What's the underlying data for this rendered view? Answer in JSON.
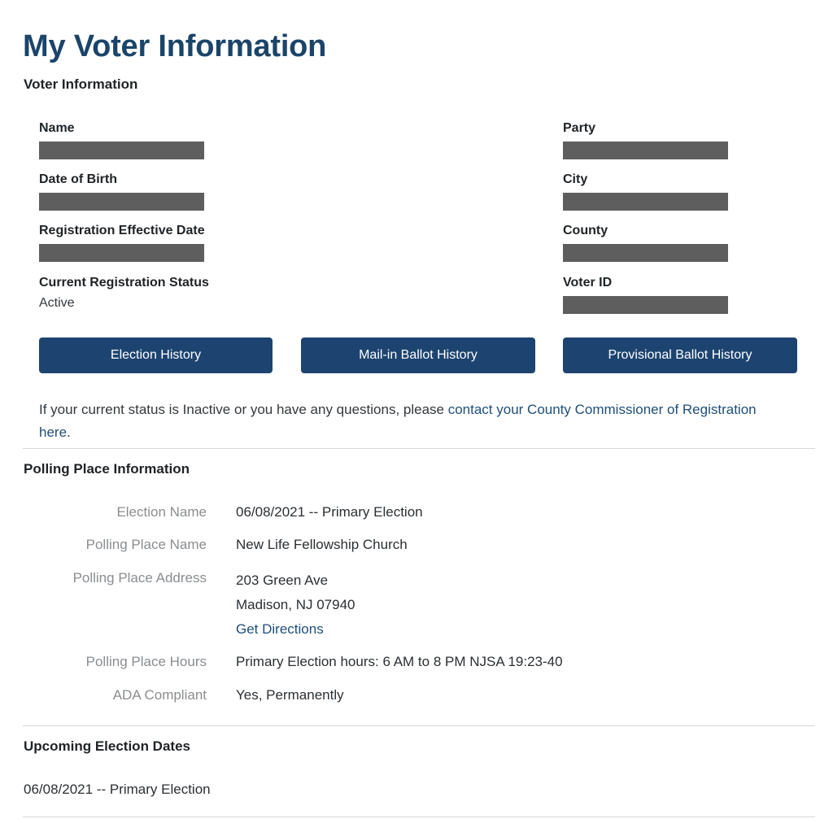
{
  "page": {
    "title": "My Voter Information"
  },
  "voter_information": {
    "heading": "Voter Information",
    "left_fields": [
      {
        "label": "Name",
        "value": "",
        "redacted": true
      },
      {
        "label": "Date of Birth",
        "value": "",
        "redacted": true
      },
      {
        "label": "Registration Effective Date",
        "value": "",
        "redacted": true
      },
      {
        "label": "Current Registration Status",
        "value": "Active",
        "redacted": false
      }
    ],
    "right_fields": [
      {
        "label": "Party",
        "value": "",
        "redacted": true
      },
      {
        "label": "City",
        "value": "",
        "redacted": true
      },
      {
        "label": "County",
        "value": "",
        "redacted": true
      },
      {
        "label": "Voter ID",
        "value": "",
        "redacted": true
      }
    ],
    "buttons": [
      {
        "label": "Election History"
      },
      {
        "label": "Mail-in Ballot History"
      },
      {
        "label": "Provisional Ballot History"
      }
    ],
    "status_note": {
      "text_before": "If your current status is Inactive or you have any questions, please ",
      "link_text": "contact your County Commissioner of Registration here",
      "text_after": "."
    }
  },
  "polling_place_information": {
    "heading": "Polling Place Information",
    "rows": [
      {
        "label": "Election Name",
        "value": "06/08/2021 -- Primary Election"
      },
      {
        "label": "Polling Place Name",
        "value": "New Life Fellowship Church"
      },
      {
        "label": "Polling Place Hours",
        "value": "Primary Election hours: 6 AM to 8 PM NJSA 19:23-40"
      },
      {
        "label": "ADA Compliant",
        "value": "Yes, Permanently"
      }
    ],
    "address_row": {
      "label": "Polling Place Address",
      "line1": "203 Green Ave",
      "line2": "Madison, NJ 07940",
      "directions_link": "Get Directions"
    }
  },
  "upcoming_election_dates": {
    "heading": "Upcoming Election Dates",
    "items": [
      "06/08/2021 -- Primary Election"
    ]
  },
  "colors": {
    "title_navy": "#1b4469",
    "button_navy": "#1d4470",
    "link_blue": "#1f4e79",
    "redaction_gray": "#5e5e5e",
    "label_gray": "#8a8d90",
    "divider_gray": "#d8d8d8"
  }
}
